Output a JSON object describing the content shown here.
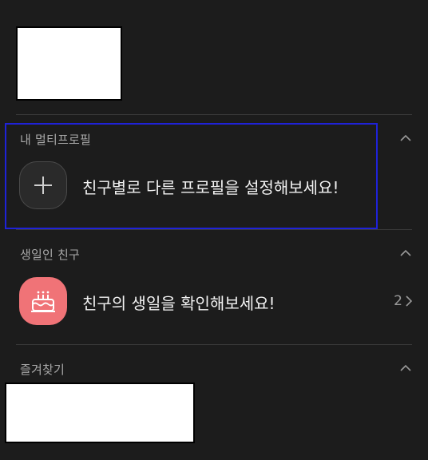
{
  "sections": {
    "multi_profile": {
      "title": "내 멀티프로필",
      "row_text": "친구별로 다른 프로필을 설정해보세요!",
      "icon": "plus-icon"
    },
    "birthday": {
      "title": "생일인 친구",
      "row_text": "친구의 생일을 확인해보세요!",
      "count": "2",
      "icon": "cake-icon"
    },
    "favorites": {
      "title": "즐겨찾기"
    }
  },
  "colors": {
    "background": "#1c1c1c",
    "highlight": "#1f22d8",
    "birthday_icon_bg": "#f07377"
  }
}
